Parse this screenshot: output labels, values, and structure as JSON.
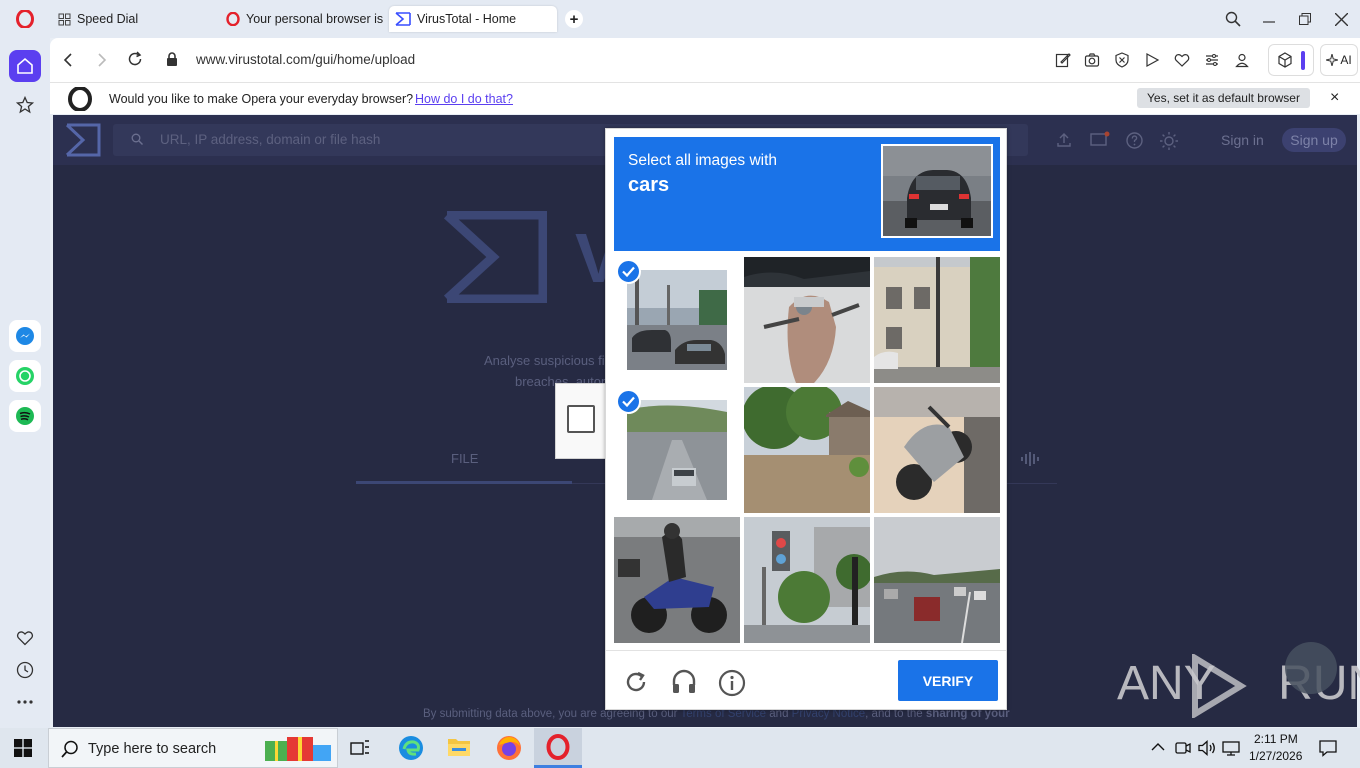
{
  "browser": {
    "tabs": [
      {
        "label": "Speed Dial",
        "icon": "speed-dial-icon"
      },
      {
        "label": "Your personal browser is a",
        "icon": "opera-icon"
      },
      {
        "label": "VirusTotal - Home",
        "icon": "virustotal-icon",
        "active": true
      }
    ],
    "new_tab_label": "+",
    "address": "www.virustotal.com/gui/home/upload",
    "ai_label": "AI",
    "infobar": {
      "question": "Would you like to make Opera your everyday browser?",
      "link": "How do I do that?",
      "button": "Yes, set it as default browser",
      "close": "×"
    }
  },
  "page": {
    "search_placeholder": "URL, IP address, domain or file hash",
    "sign_in": "Sign in",
    "sign_up": "Sign up",
    "logo_partial": "V",
    "tagline_1": "Analyse suspicious fi",
    "tagline_2": "breaches, autom",
    "tab_file": "FILE",
    "footer_prefix": "By submitting data above, you are agreeing to our ",
    "footer_tos": "Terms of Service",
    "footer_and": " and ",
    "footer_privacy": "Privacy Notice",
    "footer_suffix": ", and to the ",
    "footer_bold": "sharing of your"
  },
  "captcha": {
    "instruction": "Select all images with",
    "target": "cars",
    "verify_label": "VERIFY",
    "tiles": [
      {
        "name": "tile-street-cars",
        "selected": true
      },
      {
        "name": "tile-scooter",
        "selected": false
      },
      {
        "name": "tile-house",
        "selected": false
      },
      {
        "name": "tile-highway-bridge",
        "selected": true
      },
      {
        "name": "tile-trees-house",
        "selected": false
      },
      {
        "name": "tile-parked-motorcycle",
        "selected": false
      },
      {
        "name": "tile-motorcyclist",
        "selected": false
      },
      {
        "name": "tile-traffic-light",
        "selected": false
      },
      {
        "name": "tile-highway-traffic",
        "selected": false
      }
    ]
  },
  "watermark": "ANY RUN",
  "taskbar": {
    "search_placeholder": "Type here to search",
    "time": "2:11 PM",
    "date": "1/27/2026"
  },
  "colors": {
    "captcha_blue": "#1a73e8",
    "page_bg": "#262a43",
    "opera_red": "#e4212b",
    "sidebar_active": "#5b3ff0"
  }
}
